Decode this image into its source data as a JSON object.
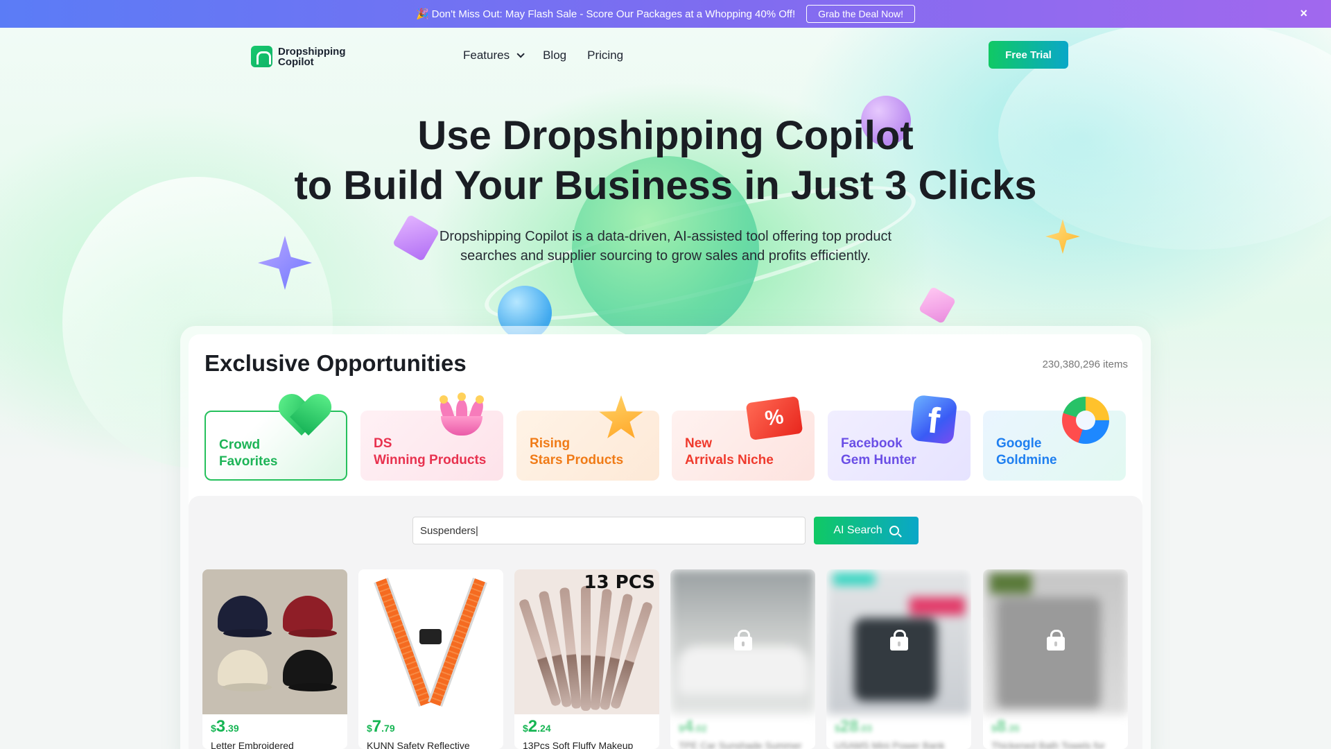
{
  "promo": {
    "emoji": "🎉",
    "text": "Don't Miss Out: May Flash Sale - Score Our Packages at a Whopping 40% Off!",
    "cta": "Grab the Deal Now!",
    "close": "×"
  },
  "nav": {
    "logo_line1": "Dropshipping",
    "logo_line2": "Copilot",
    "links": [
      "Features",
      "Blog",
      "Pricing"
    ],
    "cta": "Free Trial"
  },
  "hero": {
    "title_line1": "Use Dropshipping Copilot",
    "title_line2": "to Build Your Business in Just 3 Clicks",
    "subtitle_line1": "Dropshipping Copilot is a data-driven, AI-assisted tool offering top product",
    "subtitle_line2": "searches and supplier sourcing to grow sales and profits efficiently."
  },
  "panel": {
    "title": "Exclusive Opportunities",
    "count": "230,380,296 items",
    "categories": [
      {
        "line1": "Crowd",
        "line2": "Favorites",
        "icon": "heart-icon",
        "color": "#1db457"
      },
      {
        "line1": "DS",
        "line2": "Winning Products",
        "icon": "crown-icon",
        "color": "#e8324f"
      },
      {
        "line1": "Rising",
        "line2": "Stars Products",
        "icon": "star-icon",
        "color": "#f07b17"
      },
      {
        "line1": "New",
        "line2": "Arrivals Niche",
        "icon": "percent-ticket-icon",
        "color": "#ef3a2d"
      },
      {
        "line1": "Facebook",
        "line2": "Gem Hunter",
        "icon": "facebook-icon",
        "color": "#6a4ee6"
      },
      {
        "line1": "Google",
        "line2": "Goldmine",
        "icon": "donut-chart-icon",
        "color": "#1f7ff0"
      }
    ]
  },
  "search": {
    "value": "Suspenders|",
    "button": "AI Search"
  },
  "products": [
    {
      "currency": "$",
      "price_int": "3",
      "price_dec": ".39",
      "name": "Letter Embroidered",
      "locked": false
    },
    {
      "currency": "$",
      "price_int": "7",
      "price_dec": ".79",
      "name": "KUNN Safety Reflective",
      "locked": false
    },
    {
      "currency": "$",
      "price_int": "2",
      "price_dec": ".24",
      "name": "13Pcs Soft Fluffy Makeup",
      "locked": false,
      "badge": "13 PCS"
    },
    {
      "currency": "$",
      "price_int": "4",
      "price_dec": ".02",
      "name": "TPE Car Sunshade Summer",
      "locked": true
    },
    {
      "currency": "$",
      "price_int": "28",
      "price_dec": ".03",
      "name": "USAMS Mini Power Bank",
      "locked": true
    },
    {
      "currency": "$",
      "price_int": "8",
      "price_dec": ".35",
      "name": "Thickened Bath Towels for",
      "locked": true
    }
  ]
}
